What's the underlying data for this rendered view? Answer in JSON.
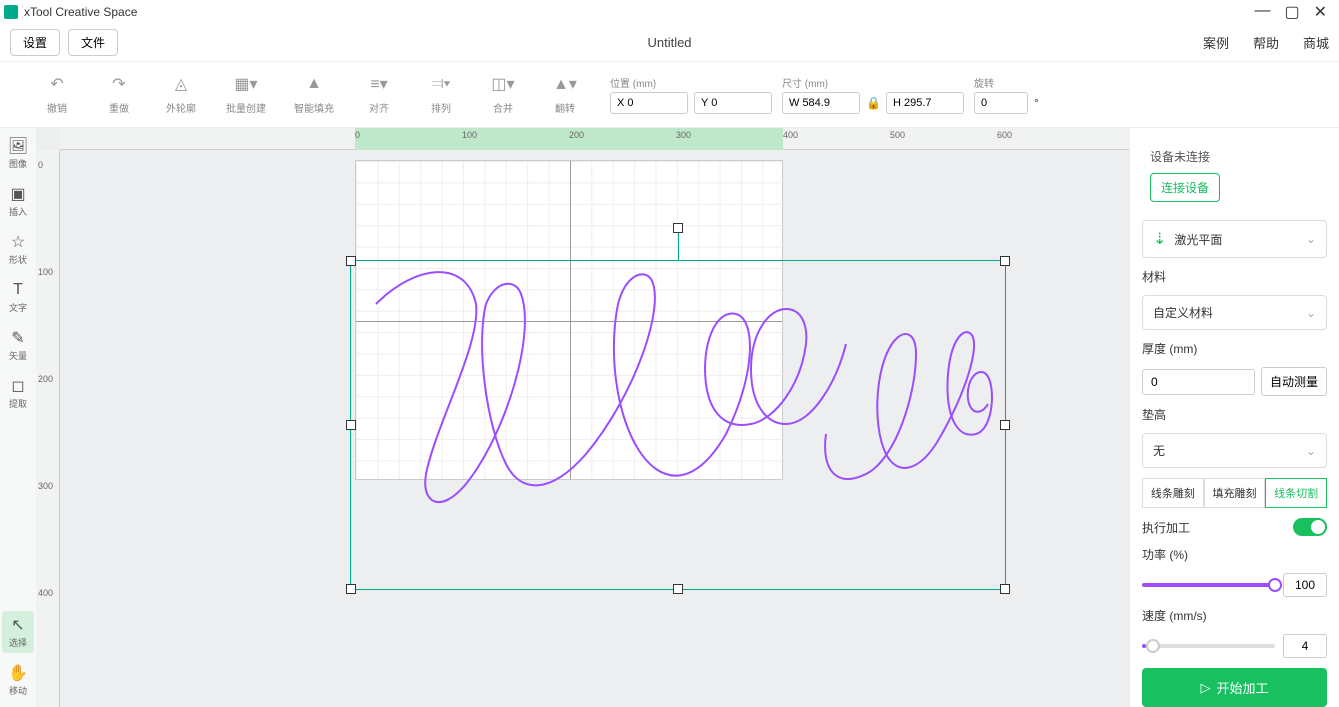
{
  "app": {
    "title": "xTool Creative Space"
  },
  "menu": {
    "settings": "设置",
    "file": "文件",
    "doc_title": "Untitled",
    "examples": "案例",
    "help": "帮助",
    "store": "商城"
  },
  "toolbar": {
    "undo": "撤销",
    "redo": "重做",
    "outline": "外轮廓",
    "batch_create": "批量创建",
    "smart_fill": "智能填充",
    "align": "对齐",
    "arrange": "排列",
    "combine": "合并",
    "flip": "翻转",
    "pos_label": "位置 (mm)",
    "x_value": "X 0",
    "y_value": "Y 0",
    "size_label": "尺寸 (mm)",
    "w_value": "W 584.9",
    "h_value": "H 295.7",
    "rot_label": "旋转",
    "rot_value": "0",
    "rot_unit": "°"
  },
  "ruler": {
    "h": [
      "0",
      "100",
      "200",
      "300",
      "400",
      "500",
      "600"
    ],
    "v": [
      "0",
      "100",
      "200",
      "300",
      "400"
    ]
  },
  "left_tools": {
    "image": "图像",
    "insert": "插入",
    "shape": "形状",
    "text": "文字",
    "vector": "矢量",
    "extract": "提取",
    "select": "选择",
    "move": "移动"
  },
  "right": {
    "device_status": "设备未连接",
    "connect_btn": "连接设备",
    "mode_label": "激光平面",
    "material_label": "材料",
    "material_value": "自定义材料",
    "thickness_label": "厚度 (mm)",
    "thickness_value": "0",
    "auto_measure": "自动测量",
    "riser_label": "垫高",
    "riser_value": "无",
    "tab_line_engrave": "线条雕刻",
    "tab_fill_engrave": "填充雕刻",
    "tab_line_cut": "线条切割",
    "execute_label": "执行加工",
    "power_label": "功率 (%)",
    "power_value": "100",
    "speed_label": "速度 (mm/s)",
    "speed_value": "4",
    "start_btn": "开始加工"
  }
}
